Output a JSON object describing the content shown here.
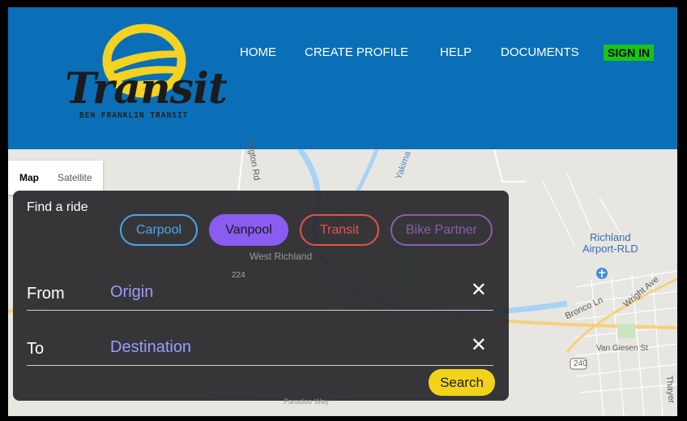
{
  "header": {
    "logo": {
      "wordmark": "Transit",
      "subtitle": "BEN FRANKLIN TRANSIT"
    },
    "nav": [
      {
        "id": "home",
        "label": "HOME"
      },
      {
        "id": "create-profile",
        "label": "CREATE PROFILE"
      },
      {
        "id": "help",
        "label": "HELP"
      },
      {
        "id": "documents",
        "label": "DOCUMENTS"
      },
      {
        "id": "sign-in",
        "label": "SIGN IN"
      }
    ],
    "colors": {
      "background": "#0a6fb7",
      "sign_in_highlight": "#19c419"
    }
  },
  "map": {
    "type_control": {
      "map": "Map",
      "satellite": "Satellite",
      "selected": "Map"
    },
    "labels": {
      "west_richland": "West Richland",
      "airport_line1": "Richland",
      "airport_line2": "Airport-RLD",
      "van_giesen": "Van Giesen St",
      "bronco": "Bronco Ln",
      "wright": "Wright Ave",
      "paradise": "Paradise Way",
      "yakima": "Yakima",
      "road_224": "224",
      "road_240": "240",
      "thayer": "Thayer"
    }
  },
  "ride_panel": {
    "title": "Find a ride",
    "modes": [
      {
        "id": "carpool",
        "label": "Carpool",
        "color": "#4aa8e8",
        "selected": false
      },
      {
        "id": "vanpool",
        "label": "Vanpool",
        "color": "#8a5cf0",
        "selected": true
      },
      {
        "id": "transit",
        "label": "Transit",
        "color": "#e5524d",
        "selected": false
      },
      {
        "id": "bike-partner",
        "label": "Bike Partner",
        "color": "#8b5ea8",
        "selected": false
      }
    ],
    "from": {
      "label": "From",
      "placeholder": "Origin",
      "value": "",
      "clear_icon": "close-icon"
    },
    "to": {
      "label": "To",
      "placeholder": "Destination",
      "value": "",
      "clear_icon": "close-icon"
    },
    "search_label": "Search",
    "search_color": "#f2d31b"
  }
}
